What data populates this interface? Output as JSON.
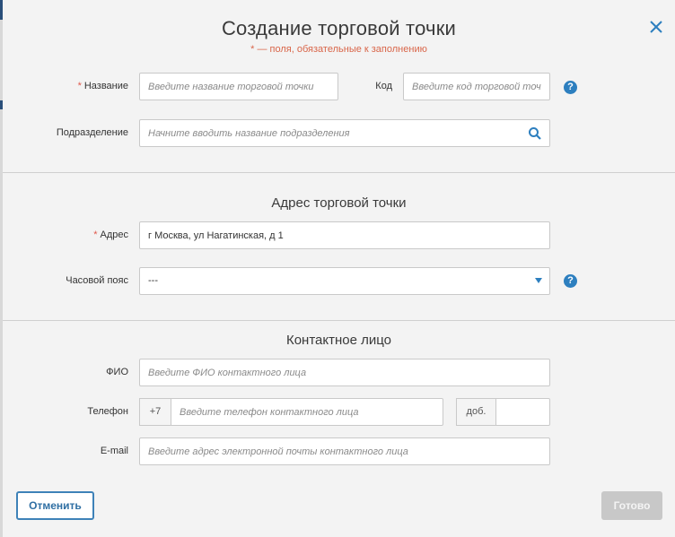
{
  "title": "Создание торговой точки",
  "subtitle": "* — поля, обязательные к заполнению",
  "required_mark": "*",
  "help_glyph": "?",
  "general": {
    "name": {
      "label": "Название",
      "placeholder": "Введите название торговой точки"
    },
    "code": {
      "label": "Код",
      "placeholder": "Введите код торговой точки"
    },
    "division": {
      "label": "Подразделение",
      "placeholder": "Начните вводить название подразделения"
    }
  },
  "address_section": {
    "title": "Адрес торговой точки",
    "address": {
      "label": "Адрес",
      "value": "г Москва, ул Нагатинская, д 1"
    },
    "timezone": {
      "label": "Часовой пояс",
      "value": "---"
    }
  },
  "contact_section": {
    "title": "Контактное лицо",
    "fio": {
      "label": "ФИО",
      "placeholder": "Введите ФИО контактного лица"
    },
    "phone": {
      "label": "Телефон",
      "prefix": "+7",
      "placeholder": "Введите телефон контактного лица",
      "ext_label": "доб.",
      "ext_value": ""
    },
    "email": {
      "label": "E-mail",
      "placeholder": "Введите адрес электронной почты контактного лица"
    }
  },
  "buttons": {
    "cancel": "Отменить",
    "done": "Готово"
  },
  "icons": {
    "close": "close-icon",
    "search": "search-icon",
    "help": "help-icon",
    "dropdown": "chevron-down-icon"
  },
  "colors": {
    "accent": "#2d7fbf",
    "required": "#e0584a",
    "disabled_button": "#c8c8c8"
  }
}
